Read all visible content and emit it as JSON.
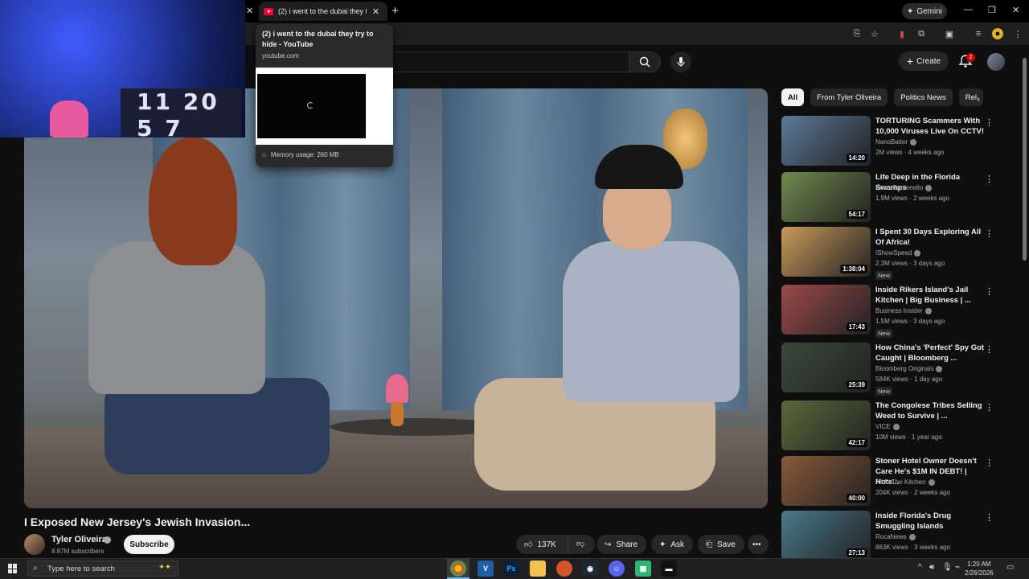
{
  "browser": {
    "tab_title": "(2) i went to the dubai they try to hide - YouTube",
    "tab_short": "(2) i went to the dubai they try",
    "gemini_label": "Gemini",
    "hovercard": {
      "title": "(2) i went to the dubai they try to hide - YouTube",
      "url": "youtube.com",
      "memory": "Memory usage: 260 MB"
    }
  },
  "header": {
    "create_label": "Create",
    "notif_count": "2"
  },
  "video": {
    "title": "I Exposed New Jersey's Jewish Invasion...",
    "channel": "Tyler Oliveira",
    "subscribers": "8.87M subscribers",
    "subscribe_label": "Subscribe",
    "likes": "137K",
    "share_label": "Share",
    "ask_label": "Ask",
    "save_label": "Save"
  },
  "webcam": {
    "jersey_text": "11 20 5 7"
  },
  "sidebar": {
    "chips": [
      "All",
      "From Tyler Oliveira",
      "Politics News",
      "Rel"
    ],
    "recommendations": [
      {
        "title": "TORTURING Scammers With 10,000 Viruses Live On CCTV!",
        "channel": "NanoBaiter",
        "meta": "2M views · 4 weeks ago",
        "duration": "14:20",
        "new": "",
        "thumb": "#5d7a9b"
      },
      {
        "title": "Life Deep in the Florida Swamps",
        "channel": "Peter Santenello",
        "meta": "1.9M views · 2 weeks ago",
        "duration": "54:17",
        "new": "",
        "thumb": "#6f8a4e"
      },
      {
        "title": "I Spent 30 Days Exploring All Of Africa!",
        "channel": "IShowSpeed",
        "meta": "2.3M views · 3 days ago",
        "duration": "1:38:04",
        "new": "New",
        "thumb": "#c99a5a"
      },
      {
        "title": "Inside Rikers Island's Jail Kitchen | Big Business | ...",
        "channel": "Business Insider",
        "meta": "1.5M views · 3 days ago",
        "duration": "17:43",
        "new": "New",
        "thumb": "#9c4a4a"
      },
      {
        "title": "How China's 'Perfect' Spy Got Caught | Bloomberg ...",
        "channel": "Bloomberg Originals",
        "meta": "584K views · 1 day ago",
        "duration": "25:39",
        "new": "New",
        "thumb": "#3a4a3a"
      },
      {
        "title": "The Congolese Tribes Selling Weed to Survive | ...",
        "channel": "VICE",
        "meta": "10M views · 1 year ago",
        "duration": "42:17",
        "new": "",
        "thumb": "#5a6a3a"
      },
      {
        "title": "Stoner Hotel Owner Doesn't Care He's $1M IN DEBT! | Hote...",
        "channel": "All In The Kitchen",
        "meta": "204K views · 2 weeks ago",
        "duration": "40:00",
        "new": "",
        "thumb": "#8a5a3a"
      },
      {
        "title": "Inside Florida's Drug Smuggling Islands",
        "channel": "RocaNews",
        "meta": "863K views · 3 weeks ago",
        "duration": "27:13",
        "new": "",
        "thumb": "#4a7a8a"
      }
    ]
  },
  "taskbar": {
    "search_placeholder": "Type here to search",
    "time": "1:20 AM",
    "date": "2/26/2026"
  },
  "colors": {
    "youtube_red": "#ff0033",
    "background": "#0f0f0f",
    "chip_bg": "#272727"
  },
  "icons": [
    "search-icon",
    "mic-icon",
    "bell-icon",
    "like-icon",
    "dislike-icon",
    "share-icon",
    "sparkle-icon",
    "save-icon",
    "more-icon",
    "chevron-right-icon",
    "windows-start-icon"
  ]
}
